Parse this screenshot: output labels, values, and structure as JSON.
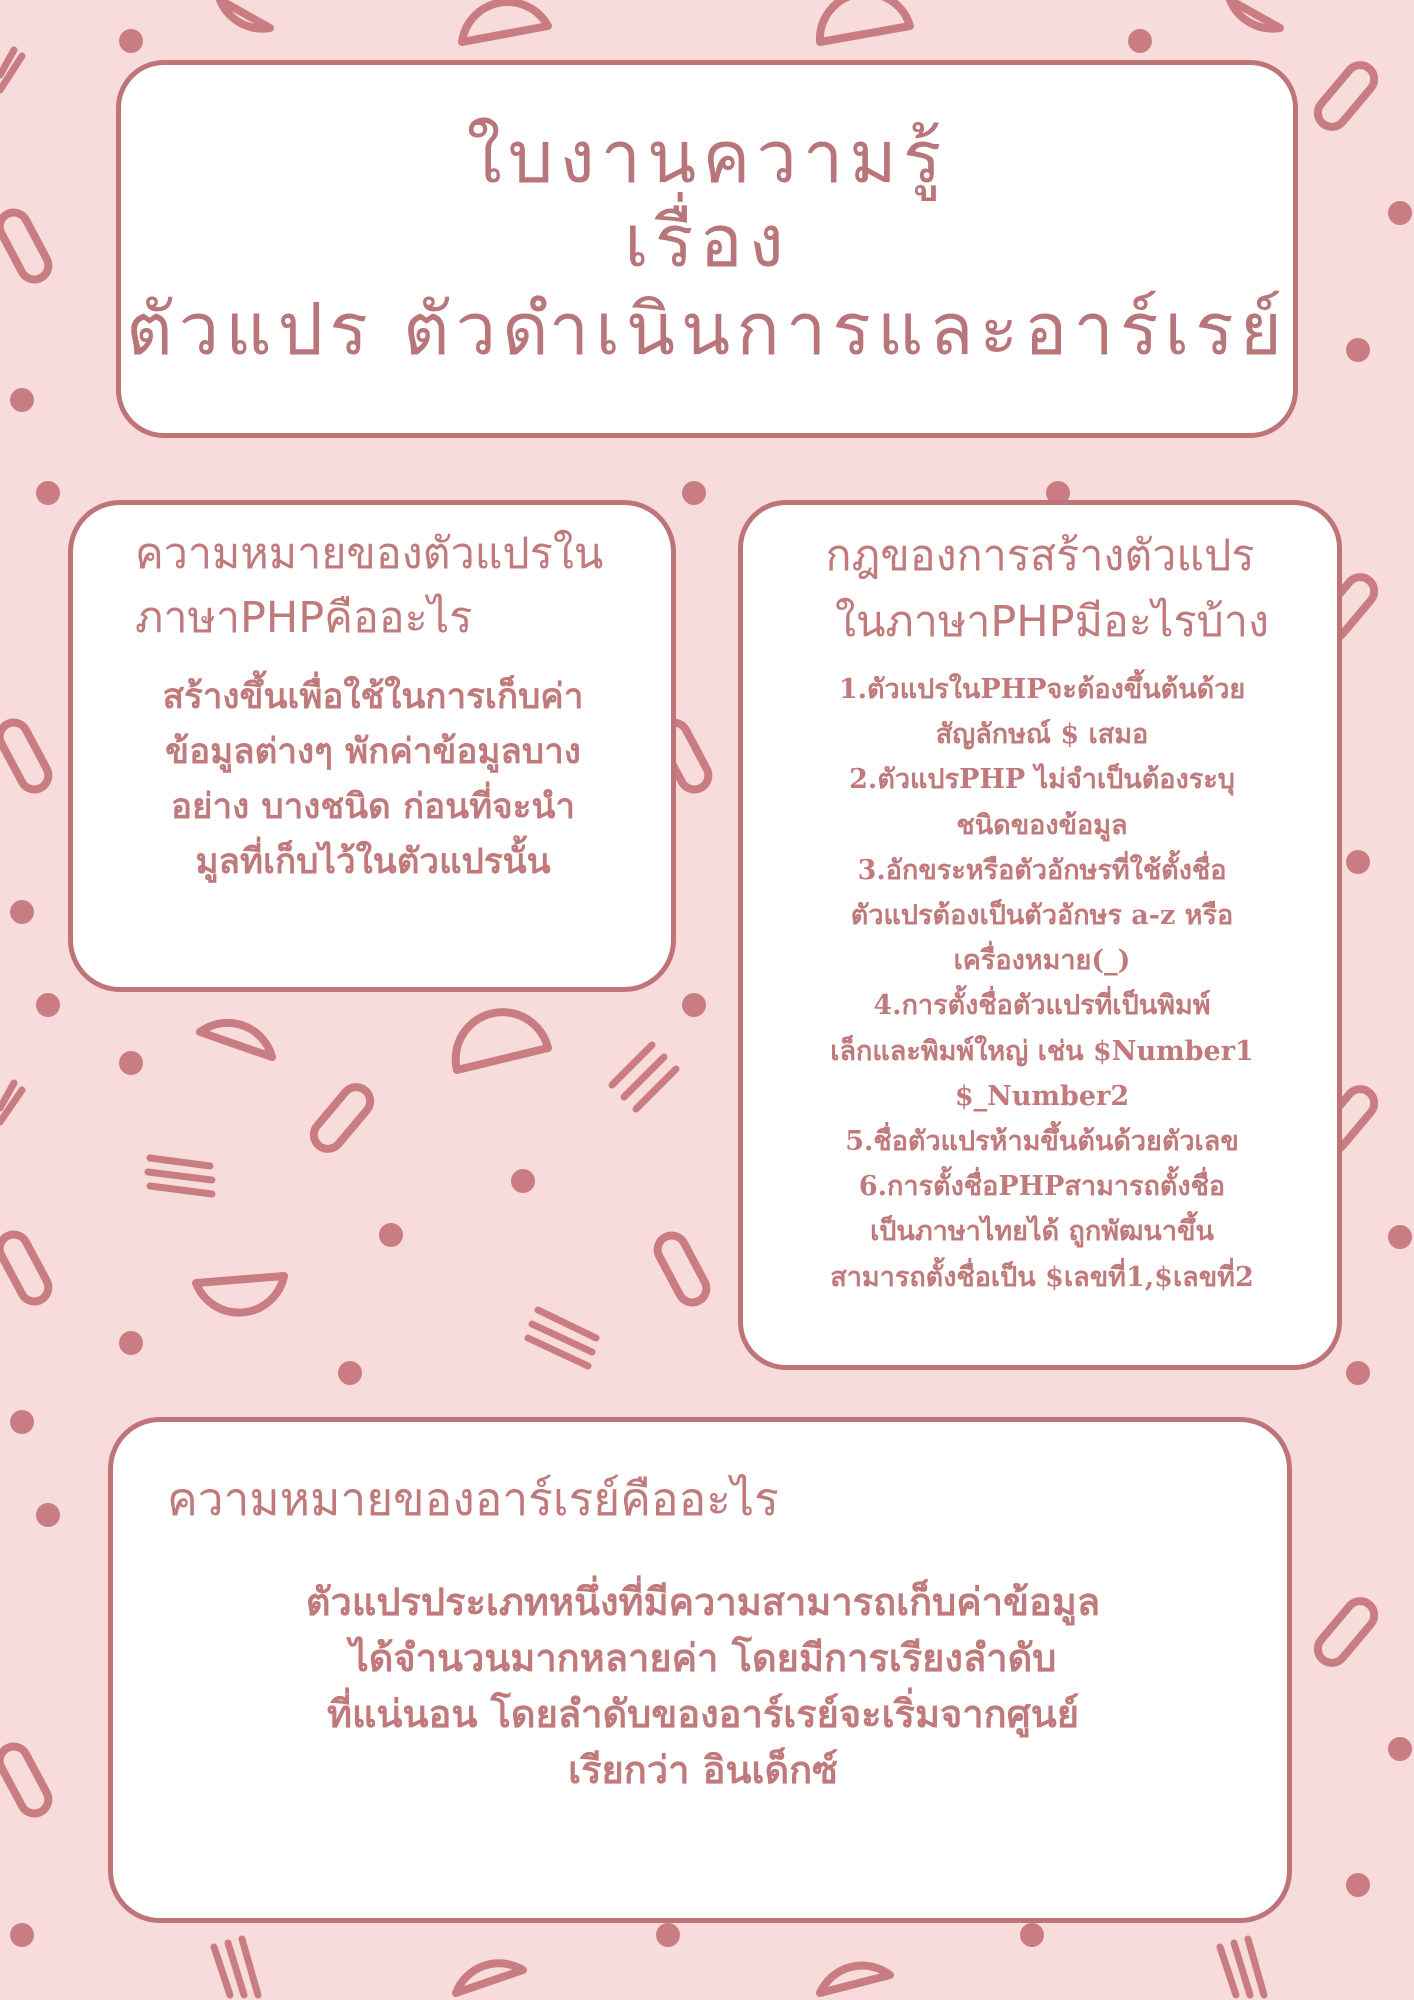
{
  "title": {
    "line1": "ใบงานความรู้",
    "line2": "เรื่อง",
    "line3": "ตัวแปร ตัวดำเนินการและอาร์เรย์"
  },
  "variable_card": {
    "heading_line1": "ความหมายของตัวแปรใน",
    "heading_line2": "ภาษาPHPคืออะไร",
    "body": [
      "สร้างขึ้นเพื่อใช้ในการเก็บค่า",
      "ข้อมูลต่างๆ พักค่าข้อมูลบาง",
      "อย่าง บางชนิด ก่อนที่จะนำ",
      "มูลที่เก็บไว้ในตัวแปรนั้น"
    ]
  },
  "rules_card": {
    "heading_line1": "กฎของการสร้างตัวแปร",
    "heading_line2": "ในภาษาPHPมีอะไรบ้าง",
    "body": [
      "1.ตัวแปรในPHPจะต้องขึ้นต้นด้วย",
      "สัญลักษณ์ $ เสมอ",
      "2.ตัวแปรPHP ไม่จำเป็นต้องระบุ",
      "ชนิดของข้อมูล",
      "3.อักขระหรือตัวอักษรที่ใช้ตั้งชื่อ",
      "ตัวแปรต้องเป็นตัวอักษร a-z หรือ",
      "เครื่องหมาย(_)",
      "4.การตั้งชื่อตัวแปรที่เป็นพิมพ์",
      "เล็กและพิมพ์ใหญ่ เช่น $Number1",
      "$_Number2",
      "5.ชื่อตัวแปรห้ามขึ้นต้นด้วยตัวเลข",
      "6.การตั้งชื่อPHPสามารถตั้งชื่อ",
      "เป็นภาษาไทยได้ ถูกพัฒนาขึ้น",
      "สามารถตั้งชื่อเป็น $เลขที่1,$เลขที่2"
    ]
  },
  "array_card": {
    "heading": "ความหมายของอาร์เรย์คืออะไร",
    "body": [
      "ตัวแปรประเภทหนึ่งที่มีความสามารถเก็บค่าข้อมูล",
      "ได้จำนวนมากหลายค่า โดยมีการเรียงลำดับ",
      "ที่แน่นอน โดยลำดับของอาร์เรย์จะเริ่มจากศูนย์",
      "เรียกว่า อินเด็กซ์"
    ]
  },
  "colors": {
    "background": "#f7dcdb",
    "accent": "#bf7478",
    "text": "#c07a7c"
  },
  "decoration": {
    "pattern": [
      "dot-shape",
      "half-circle-shape",
      "pill-shape",
      "triple-line-shape"
    ]
  }
}
